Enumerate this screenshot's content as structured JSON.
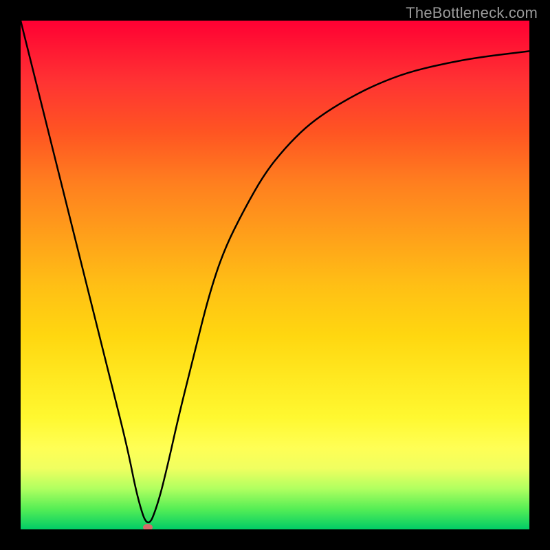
{
  "watermark": {
    "text": "TheBottleneck.com"
  },
  "chart_data": {
    "type": "line",
    "title": "",
    "xlabel": "",
    "ylabel": "",
    "xlim": [
      0,
      100
    ],
    "ylim": [
      0,
      100
    ],
    "grid": false,
    "legend": false,
    "series": [
      {
        "name": "curve",
        "x": [
          0,
          3,
          6,
          9,
          12,
          15,
          18,
          21,
          23,
          25,
          27,
          29,
          31,
          34,
          37,
          40,
          44,
          48,
          52,
          56,
          60,
          65,
          70,
          76,
          83,
          90,
          100
        ],
        "y": [
          100,
          88,
          76,
          64,
          52,
          40,
          28,
          16,
          6,
          0,
          5,
          13,
          22,
          34,
          46,
          55,
          63,
          70,
          75,
          79,
          82,
          85,
          87.5,
          89.8,
          91.5,
          92.8,
          94
        ]
      }
    ],
    "minimum_point": {
      "x": 25,
      "y": 0
    },
    "gradient_stops_top_to_bottom": [
      {
        "pos": 0,
        "color": "#ff0033"
      },
      {
        "pos": 32,
        "color": "#ff7f1f"
      },
      {
        "pos": 62,
        "color": "#ffd710"
      },
      {
        "pos": 84,
        "color": "#ffff55"
      },
      {
        "pos": 100,
        "color": "#00cc66"
      }
    ]
  }
}
